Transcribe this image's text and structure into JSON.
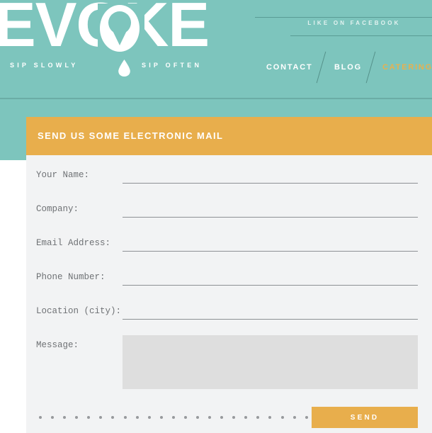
{
  "brand": {
    "logo_text": "EVOKE",
    "tagline_left": "SIP SLOWLY",
    "tagline_right": "SIP OFTEN",
    "teal": "#7dc5bd",
    "gold": "#e8ae4c"
  },
  "header": {
    "facebook_label": "LIKE ON FACEBOOK",
    "nav": [
      {
        "label": "CONTACT",
        "active": false
      },
      {
        "label": "BLOG",
        "active": false
      },
      {
        "label": "CATERING",
        "active": true
      }
    ]
  },
  "form": {
    "title": "SEND US SOME ELECTRONIC MAIL",
    "fields": [
      {
        "label": "Your Name:",
        "value": "",
        "placeholder": ""
      },
      {
        "label": "Company:",
        "value": "",
        "placeholder": ""
      },
      {
        "label": "Email Address:",
        "value": "",
        "placeholder": ""
      },
      {
        "label": "Phone Number:",
        "value": "",
        "placeholder": ""
      },
      {
        "label": "Location (city):",
        "value": "",
        "placeholder": ""
      }
    ],
    "message": {
      "label": "Message:",
      "value": "",
      "placeholder": ""
    },
    "submit_label": "SEND",
    "dot_count": 23
  }
}
